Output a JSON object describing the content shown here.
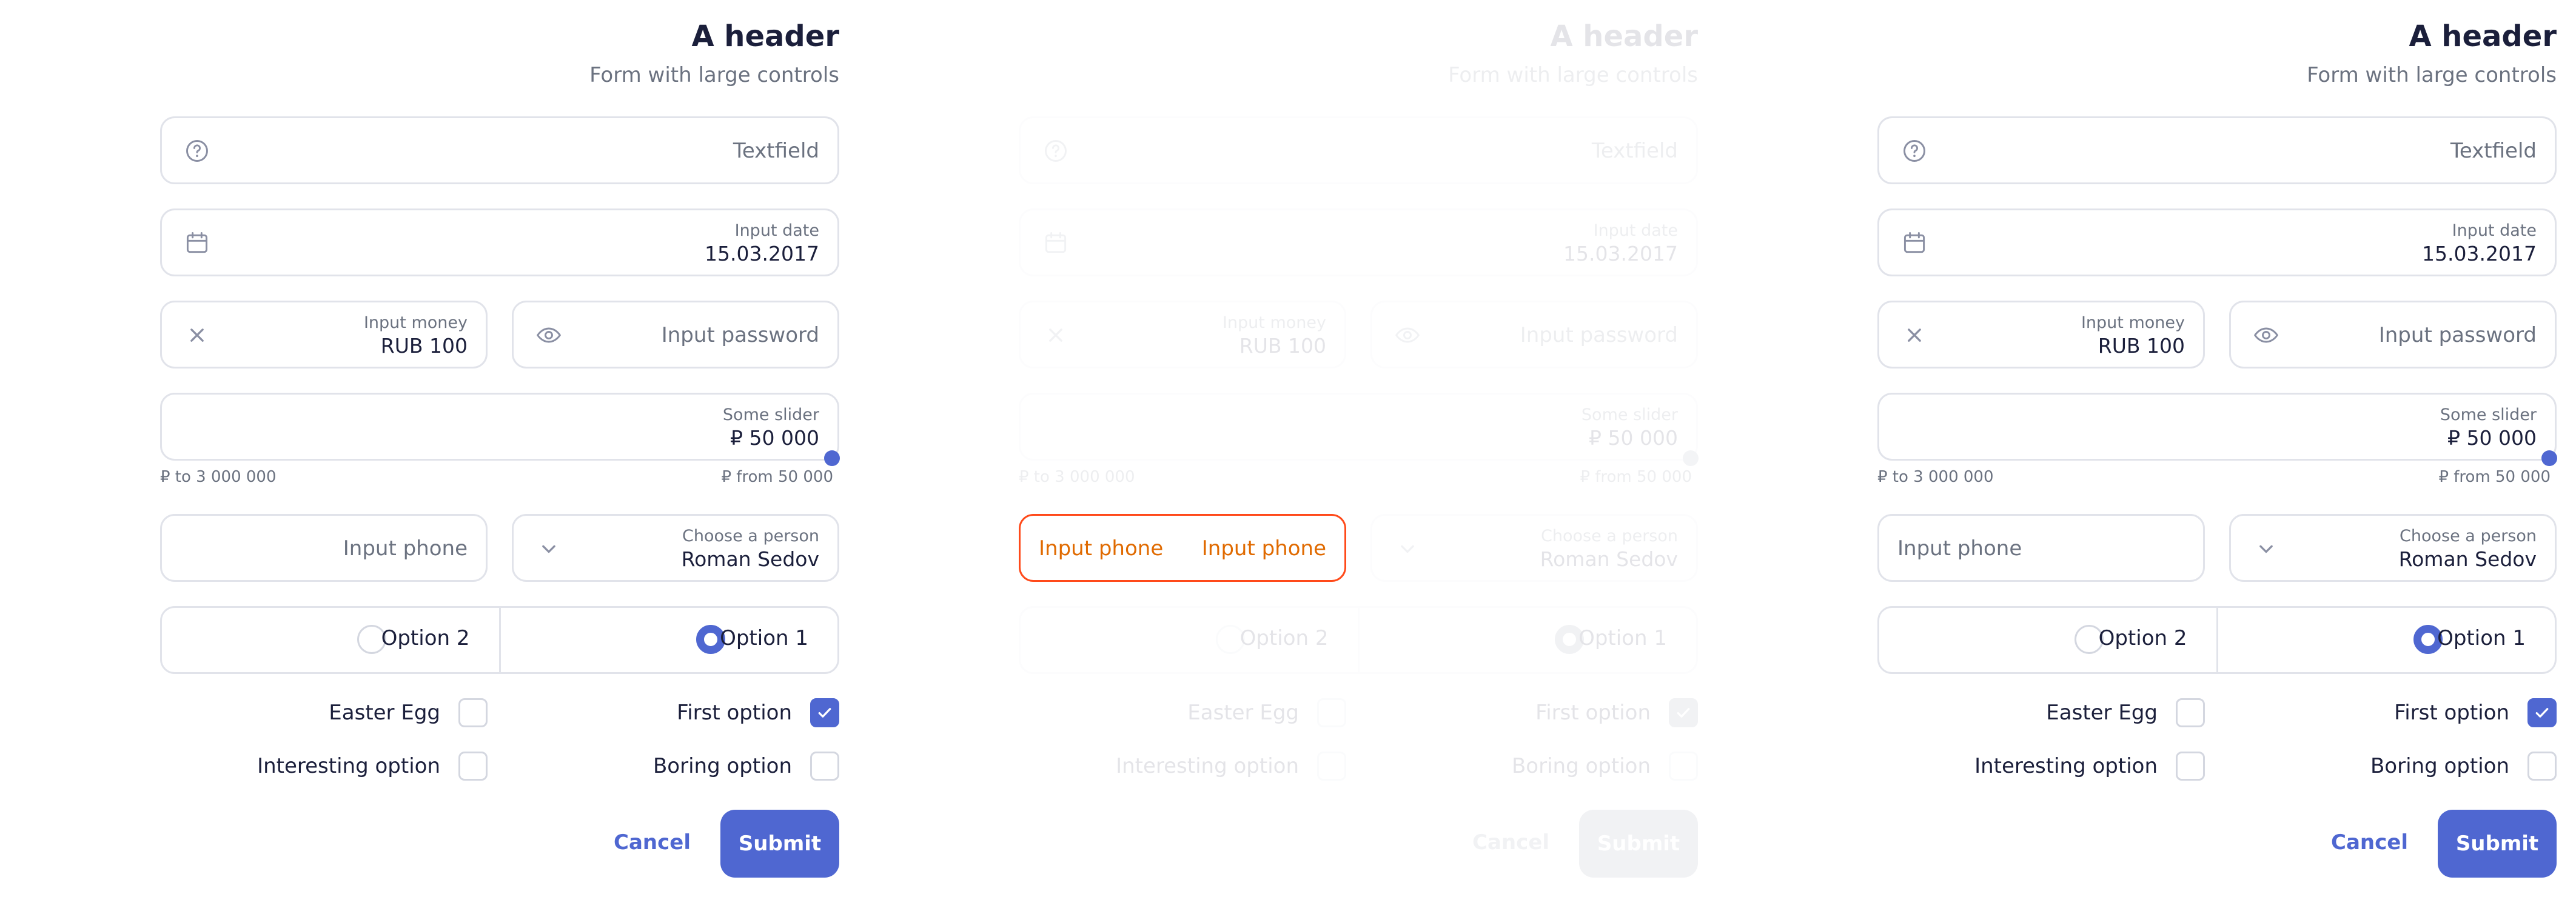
{
  "header": {
    "title": "A header",
    "subtitle": "Form with large controls"
  },
  "textfield": {
    "placeholder": "Textfield",
    "icon": "question-circle-icon"
  },
  "input_date": {
    "label": "Input date",
    "value": "15.03.2017",
    "icon": "calendar-icon"
  },
  "input_money": {
    "label": "Input money",
    "value": "RUB 100",
    "icon": "close-icon"
  },
  "input_password": {
    "placeholder": "Input password",
    "icon": "eye-icon"
  },
  "slider": {
    "label": "Some slider",
    "value": "₽ 50 000",
    "hint_left": "₽ to 3 000 000",
    "hint_right": "₽ from 50 000",
    "level": 1.0
  },
  "input_phone": {
    "placeholder": "Input phone"
  },
  "person_select": {
    "label": "Choose a person",
    "value": "Roman Sedov",
    "icon": "chevron-down-icon"
  },
  "radios": {
    "option2": "Option 2",
    "option1": "Option 1",
    "selected": "Option 1"
  },
  "checkboxes": {
    "easter_egg": {
      "label": "Easter Egg",
      "checked": false
    },
    "first_option": {
      "label": "First option",
      "checked": true
    },
    "interesting_option": {
      "label": "Interesting option",
      "checked": false
    },
    "boring_option": {
      "label": "Boring option",
      "checked": false
    }
  },
  "buttons": {
    "cancel": "Cancel",
    "submit": "Submit"
  },
  "error_state": {
    "phone_left": "Input phone",
    "phone_right": "Input phone"
  },
  "colors": {
    "accent": "#4f67d1",
    "error_border": "#ff4a1a",
    "error_text": "#e06a00",
    "text": "#1b1f3b",
    "muted": "#6b7280"
  }
}
